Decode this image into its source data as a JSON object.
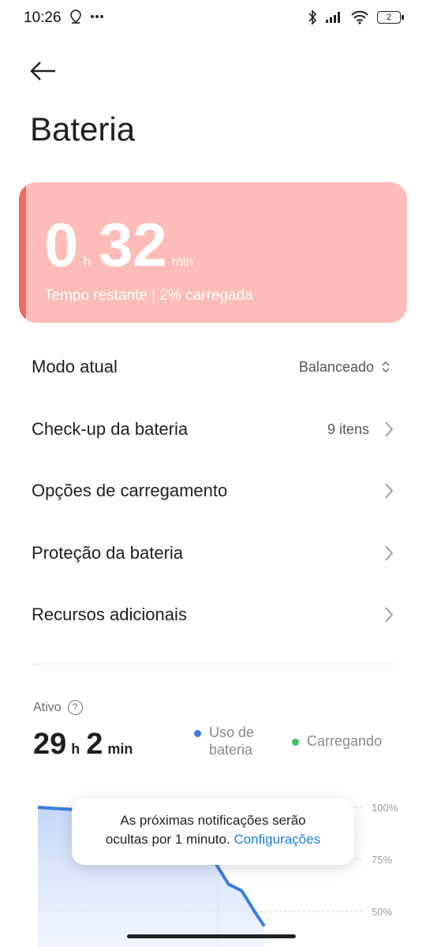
{
  "status_bar": {
    "time": "10:26",
    "battery_level": "2",
    "icons": [
      "location-icon",
      "more-dots-icon",
      "bluetooth-icon",
      "signal-icon",
      "wifi-icon",
      "battery-icon"
    ]
  },
  "header": {
    "back_icon": "arrow-left-icon",
    "title": "Bateria"
  },
  "battery_card": {
    "hours": "0",
    "hours_unit": "h",
    "minutes": "32",
    "minutes_unit": "min",
    "subtitle": "Tempo restante | 2% carregada",
    "background_color": "#fdbcb7",
    "accent_color": "#f26a5f"
  },
  "menu": {
    "items": [
      {
        "label": "Modo atual",
        "value": "Balanceado",
        "icon": "up-down-icon"
      },
      {
        "label": "Check-up da bateria",
        "value": "9 itens",
        "icon": "chevron-right-icon"
      },
      {
        "label": "Opções de carregamento",
        "value": "",
        "icon": "chevron-right-icon"
      },
      {
        "label": "Proteção da bateria",
        "value": "",
        "icon": "chevron-right-icon"
      },
      {
        "label": "Recursos adicionais",
        "value": "",
        "icon": "chevron-right-icon"
      }
    ]
  },
  "usage": {
    "label": "Ativo",
    "hours": "29",
    "hours_unit": "h",
    "minutes": "2",
    "minutes_unit": "min",
    "legend": [
      {
        "label_line1": "Uso de",
        "label_line2": "bateria",
        "color": "#3b7ddd"
      },
      {
        "label_line1": "Carregando",
        "label_line2": "",
        "color": "#3cc46b"
      }
    ]
  },
  "chart_data": {
    "type": "area",
    "y_ticks": [
      "100%",
      "75%",
      "50%"
    ],
    "ylim": [
      0,
      100
    ],
    "series": [
      {
        "name": "Uso de bateria",
        "color": "#3b7ddd",
        "points": [
          [
            0,
            100
          ],
          [
            10,
            99
          ],
          [
            20,
            98
          ],
          [
            30,
            96
          ],
          [
            40,
            93
          ],
          [
            48,
            88
          ],
          [
            52,
            80
          ],
          [
            55,
            73
          ],
          [
            59,
            63
          ],
          [
            63,
            60
          ],
          [
            67,
            50
          ],
          [
            70,
            43
          ]
        ]
      }
    ]
  },
  "toast": {
    "line1": "As próximas notificações serão",
    "line2_prefix": "ocultas por 1 minuto.",
    "link": "Configurações"
  }
}
